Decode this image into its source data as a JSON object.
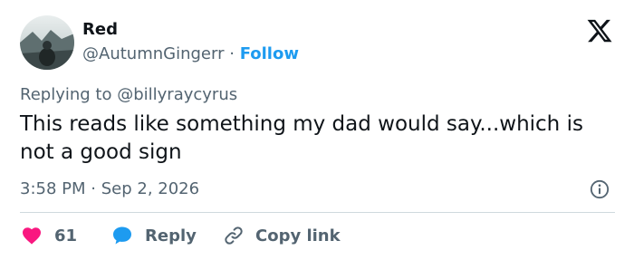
{
  "user": {
    "display_name": "Red",
    "handle": "@AutumnGingerr",
    "separator": "·",
    "follow_label": "Follow",
    "avatar_icon": "avatar-photo"
  },
  "brand": {
    "logo_icon": "x-logo-icon"
  },
  "reply_context": {
    "prefix": "Replying to",
    "mention": "@billyraycyrus"
  },
  "tweet": {
    "text": "This reads like something my dad would say...which is not a good sign",
    "time": "3:58 PM",
    "dot": "·",
    "date": "Sep 2, 2026"
  },
  "actions": {
    "likes": "61",
    "reply_label": "Reply",
    "copy_link_label": "Copy link"
  },
  "colors": {
    "accent": "#1d9bf0",
    "heart": "#f91880",
    "text": "#0f1419",
    "muted": "#536471"
  }
}
